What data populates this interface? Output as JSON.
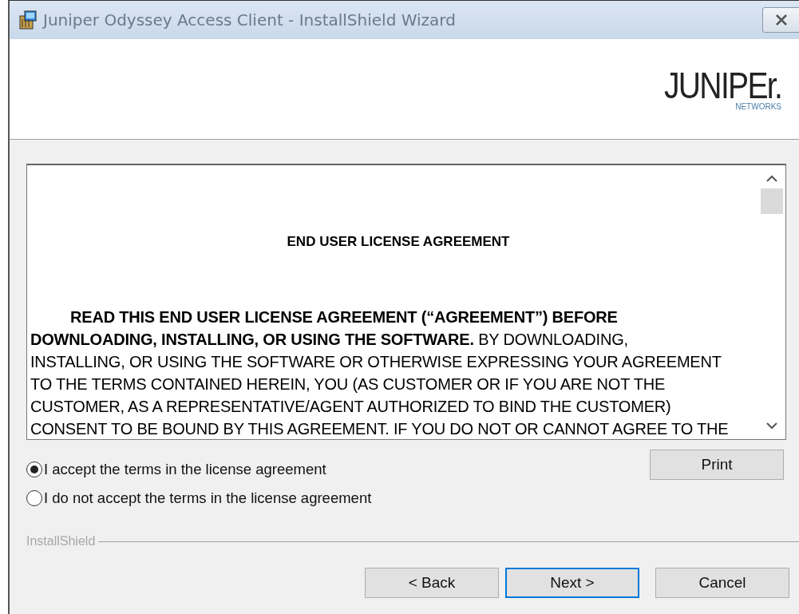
{
  "window": {
    "title": "Juniper Odyssey Access Client - InstallShield Wizard"
  },
  "logo": {
    "wordmark": "JUNIPEr.",
    "tagline": "NETWORKS"
  },
  "license": {
    "heading": "END USER LICENSE AGREEMENT",
    "paragraph": "**READ THIS END USER LICENSE AGREEMENT (“AGREEMENT”) BEFORE\nDOWNLOADING, INSTALLING, OR USING THE SOFTWARE.**  BY DOWNLOADING,\nINSTALLING, OR USING THE SOFTWARE OR OTHERWISE EXPRESSING YOUR AGREEMENT\nTO THE TERMS CONTAINED HEREIN, YOU (AS CUSTOMER OR IF YOU ARE NOT THE\nCUSTOMER, AS A REPRESENTATIVE/AGENT AUTHORIZED TO BIND THE CUSTOMER)\nCONSENT TO BE BOUND BY THIS AGREEMENT.  IF YOU DO NOT OR CANNOT AGREE TO THE"
  },
  "options": [
    {
      "label": "I accept the terms in the license agreement",
      "selected": true
    },
    {
      "label": "I do not accept the terms in the license agreement",
      "selected": false
    }
  ],
  "print_button": "Print",
  "brand_label": "InstallShield",
  "buttons": [
    {
      "label": "< Back",
      "default": false
    },
    {
      "label": "Next >",
      "default": true
    },
    {
      "label": "Cancel",
      "default": false
    }
  ]
}
